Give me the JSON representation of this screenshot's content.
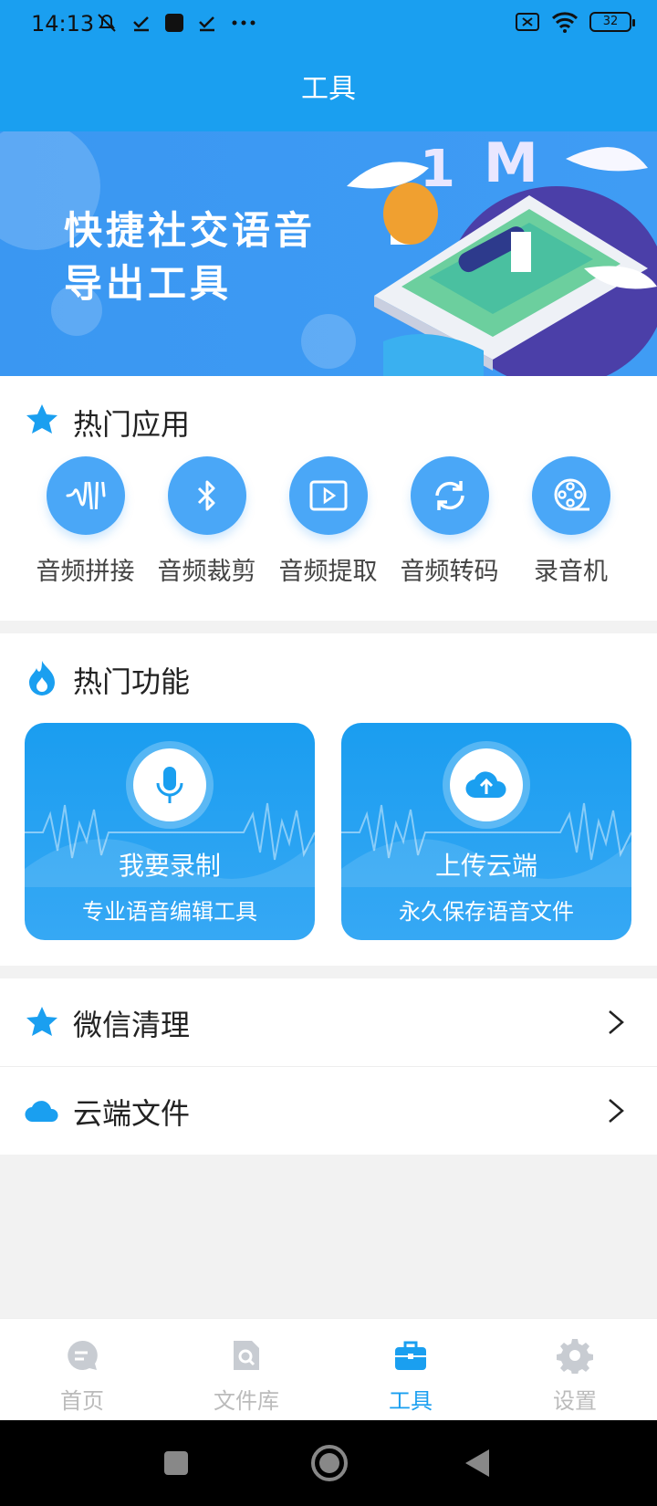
{
  "status_bar": {
    "time": "14:13",
    "battery": "32"
  },
  "header": {
    "title": "工具"
  },
  "banner": {
    "line1": "快捷社交语音",
    "line2": "导出工具"
  },
  "hot_apps": {
    "title": "热门应用",
    "items": [
      {
        "label": "音频拼接",
        "icon": "waveform-icon"
      },
      {
        "label": "音频裁剪",
        "icon": "bluetooth-icon"
      },
      {
        "label": "音频提取",
        "icon": "video-play-icon"
      },
      {
        "label": "音频转码",
        "icon": "refresh-icon"
      },
      {
        "label": "录音机",
        "icon": "film-reel-icon"
      }
    ]
  },
  "hot_features": {
    "title": "热门功能",
    "items": [
      {
        "title": "我要录制",
        "subtitle": "专业语音编辑工具",
        "icon": "microphone-icon"
      },
      {
        "title": "上传云端",
        "subtitle": "永久保存语音文件",
        "icon": "cloud-upload-icon"
      }
    ]
  },
  "list": [
    {
      "label": "微信清理",
      "icon": "star-icon"
    },
    {
      "label": "云端文件",
      "icon": "cloud-icon"
    }
  ],
  "bottom_nav": [
    {
      "label": "首页",
      "icon": "chat-icon"
    },
    {
      "label": "文件库",
      "icon": "file-search-icon"
    },
    {
      "label": "工具",
      "icon": "briefcase-icon",
      "active": true
    },
    {
      "label": "设置",
      "icon": "gear-icon"
    }
  ],
  "colors": {
    "accent": "#1a9ff0",
    "banner": "#3f9cf4",
    "background": "#f2f2f2"
  }
}
